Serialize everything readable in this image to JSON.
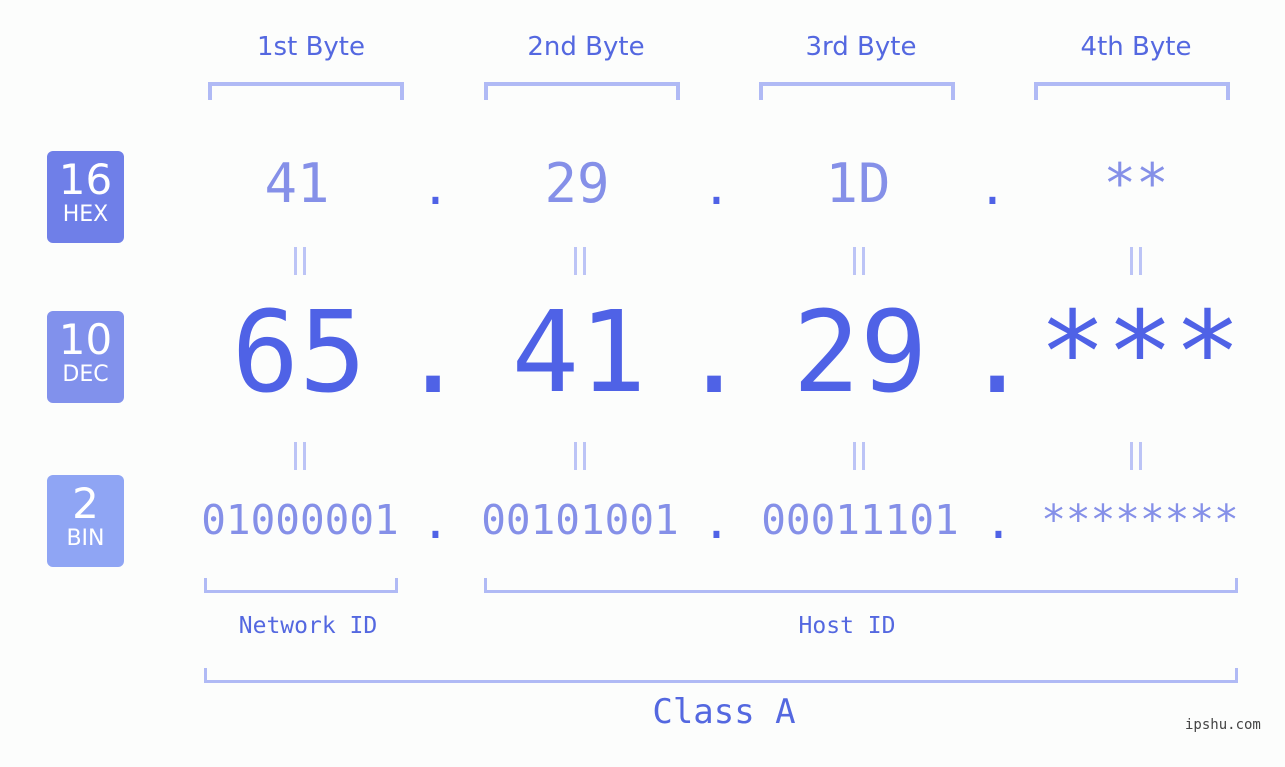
{
  "headers": [
    "1st Byte",
    "2nd Byte",
    "3rd Byte",
    "4th Byte"
  ],
  "badges": [
    {
      "num": "16",
      "label": "HEX",
      "color": "#6f7fe8"
    },
    {
      "num": "10",
      "label": "DEC",
      "color": "#8191ec"
    },
    {
      "num": "2",
      "label": "BIN",
      "color": "#8fa5f4"
    }
  ],
  "hex": [
    "41",
    "29",
    "1D",
    "**"
  ],
  "dec": [
    "65",
    "41",
    "29",
    "***"
  ],
  "bin": [
    "01000001",
    "00101001",
    "00011101",
    "********"
  ],
  "separator": ".",
  "network_label": "Network ID",
  "host_label": "Host ID",
  "class_label": "Class A",
  "watermark": "ipshu.com"
}
